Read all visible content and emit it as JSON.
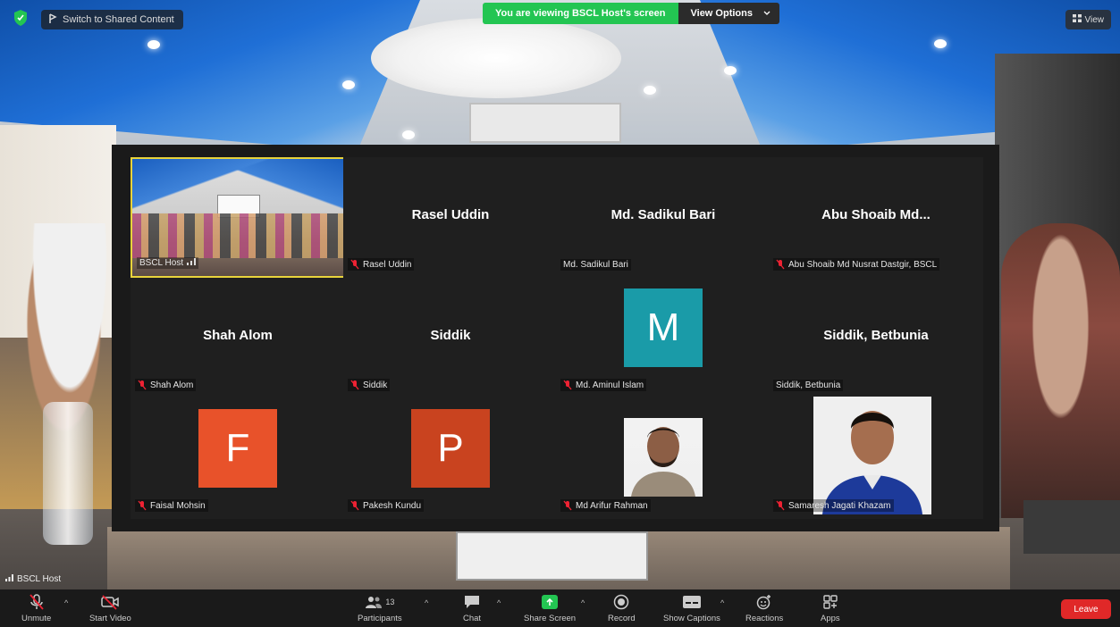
{
  "topbar": {
    "switch_label": "Switch to Shared Content",
    "viewing_banner": "You are viewing BSCL Host's screen",
    "view_options": "View Options",
    "view_button": "View"
  },
  "main_view": {
    "host_label": "BSCL Host"
  },
  "gallery": {
    "tiles": [
      {
        "center_name": "",
        "label": "BSCL Host"
      },
      {
        "center_name": "Rasel Uddin",
        "label": "Rasel Uddin",
        "muted": true
      },
      {
        "center_name": "Md. Sadikul Bari",
        "label": "Md. Sadikul Bari",
        "muted": false
      },
      {
        "center_name": "Abu Shoaib Md...",
        "label": "Abu Shoaib Md Nusrat Dastgir, BSCL",
        "muted": true
      },
      {
        "center_name": "Shah Alom",
        "label": "Shah Alom",
        "muted": true
      },
      {
        "center_name": "Siddik",
        "label": "Siddik",
        "muted": true
      },
      {
        "center_name": "",
        "avatar_letter": "M",
        "avatar_color": "#1a9ba8",
        "label": "Md. Aminul Islam",
        "muted": true
      },
      {
        "center_name": "Siddik, Betbunia",
        "label": "Siddik, Betbunia",
        "muted": false
      },
      {
        "center_name": "",
        "avatar_letter": "F",
        "avatar_color": "#e8522a",
        "label": "Faisal Mohsin",
        "muted": true
      },
      {
        "center_name": "",
        "avatar_letter": "P",
        "avatar_color": "#c9431f",
        "label": "Pakesh Kundu",
        "muted": true
      },
      {
        "center_name": "",
        "label": "Md Arifur Rahman",
        "muted": true
      },
      {
        "center_name": "",
        "label": "Samaresh Jagati Khazam",
        "muted": true
      }
    ]
  },
  "toolbar": {
    "unmute": "Unmute",
    "start_video": "Start Video",
    "participants": "Participants",
    "participants_count": "13",
    "chat": "Chat",
    "share_screen": "Share Screen",
    "record": "Record",
    "show_captions": "Show Captions",
    "reactions": "Reactions",
    "apps": "Apps",
    "leave": "Leave"
  },
  "colors": {
    "green_banner": "#23c552",
    "leave_red": "#e02828",
    "active_border": "#e8d33b"
  }
}
